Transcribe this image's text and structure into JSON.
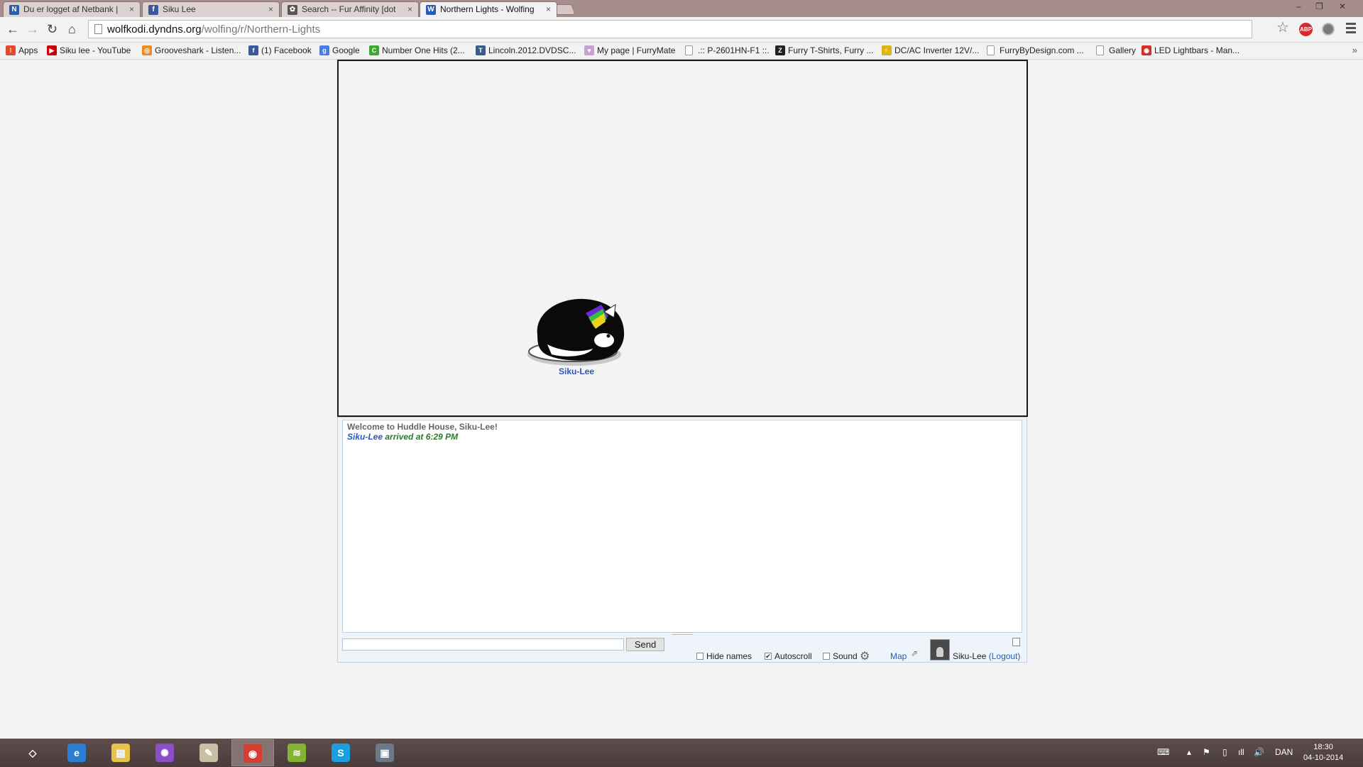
{
  "browser": {
    "tabs": [
      {
        "title": "Du er logget af Netbank |",
        "icon": "netbank-icon",
        "color": "#2c5fa8",
        "glyph": "N",
        "active": false
      },
      {
        "title": "Siku Lee",
        "icon": "facebook-icon",
        "color": "#3b5998",
        "glyph": "f",
        "active": false
      },
      {
        "title": "Search -- Fur Affinity [dot",
        "icon": "paw-icon",
        "color": "#555555",
        "glyph": "✿",
        "active": false
      },
      {
        "title": "Northern Lights - Wolfing",
        "icon": "wolfing-icon",
        "color": "#2a5bb5",
        "glyph": "W",
        "active": true
      }
    ],
    "tab_close_glyph": "×",
    "window_controls": [
      "–",
      "❐",
      "✕"
    ],
    "url": {
      "host": "wolfkodi.dyndns.org",
      "path": "/wolfing/r/Northern-Lights"
    },
    "nav": {
      "back": "←",
      "forward": "→",
      "reload": "↻",
      "home": "⌂"
    },
    "star_glyph": "☆",
    "abp_label": "ABP",
    "bookmarks": [
      {
        "label": "Apps",
        "icon": "apps-icon",
        "color": "#e24a2b",
        "glyph": "⁞"
      },
      {
        "label": "Siku lee - YouTube",
        "icon": "youtube-icon",
        "color": "#cc0000",
        "glyph": "▶"
      },
      {
        "label": "Grooveshark - Listen...",
        "icon": "grooveshark-icon",
        "color": "#f28a1e",
        "glyph": "◎"
      },
      {
        "label": "(1) Facebook",
        "icon": "facebook-icon",
        "color": "#3b5998",
        "glyph": "f"
      },
      {
        "label": "Google",
        "icon": "google-icon",
        "color": "#4a7de2",
        "glyph": "g"
      },
      {
        "label": "Number One Hits (2...",
        "icon": "numberone-icon",
        "color": "#3aa832",
        "glyph": "C"
      },
      {
        "label": "Lincoln.2012.DVDSC...",
        "icon": "torrent-icon",
        "color": "#3a5a8a",
        "glyph": "T"
      },
      {
        "label": "My page | FurryMate",
        "icon": "furrymate-icon",
        "color": "#c7a1d6",
        "glyph": "♥"
      },
      {
        "label": ".:: P-2601HN-F1 ::.",
        "icon": "file-icon",
        "color": "",
        "glyph": ""
      },
      {
        "label": "Furry T-Shirts, Furry ...",
        "icon": "zazzle-icon",
        "color": "#222222",
        "glyph": "Z"
      },
      {
        "label": "DC/AC Inverter 12V/...",
        "icon": "inverter-icon",
        "color": "#d6b41a",
        "glyph": "⚡"
      },
      {
        "label": "FurryByDesign.com ...",
        "icon": "file-icon",
        "color": "",
        "glyph": ""
      },
      {
        "label": "Gallery",
        "icon": "file-icon",
        "color": "",
        "glyph": ""
      },
      {
        "label": "LED Lightbars - Man...",
        "icon": "led-icon",
        "color": "#d42b2b",
        "glyph": "◉"
      }
    ],
    "bookmarks_more": "»"
  },
  "room": {
    "avatar_name": "Siku-Lee"
  },
  "chat": {
    "welcome": "Welcome to Huddle House, Siku-Lee!",
    "arrival_user": "Siku-Lee",
    "arrival_text": " arrived at 6:29 PM",
    "input_value": "",
    "send_label": "Send",
    "options": [
      {
        "label": "Hide names",
        "checked": false
      },
      {
        "label": "Autoscroll",
        "checked": true
      },
      {
        "label": "Sound",
        "checked": false
      }
    ],
    "map_label": "Map",
    "username": "Siku-Lee",
    "logout_label": "(Logout)"
  },
  "taskbar": {
    "apps": [
      {
        "name": "start-icon",
        "glyph": "◇",
        "color": "transparent",
        "active": false
      },
      {
        "name": "internet-explorer-icon",
        "glyph": "e",
        "color": "#2a7fd4",
        "active": false
      },
      {
        "name": "file-explorer-icon",
        "glyph": "▤",
        "color": "#e8c14a",
        "active": false
      },
      {
        "name": "picasa-icon",
        "glyph": "✺",
        "color": "#8a4fc9",
        "active": false
      },
      {
        "name": "notepad-icon",
        "glyph": "✎",
        "color": "#c9bfa6",
        "active": false
      },
      {
        "name": "chrome-icon",
        "glyph": "◉",
        "color": "#d63c2f",
        "active": true
      },
      {
        "name": "spotify-icon",
        "glyph": "≋",
        "color": "#82b432",
        "active": false
      },
      {
        "name": "skype-icon",
        "glyph": "S",
        "color": "#1aa0e0",
        "active": false
      },
      {
        "name": "remote-desktop-icon",
        "glyph": "▣",
        "color": "#6a7a8a",
        "active": false
      }
    ],
    "tray": {
      "language": "DAN",
      "time": "18:30",
      "date": "04-10-2014"
    }
  }
}
